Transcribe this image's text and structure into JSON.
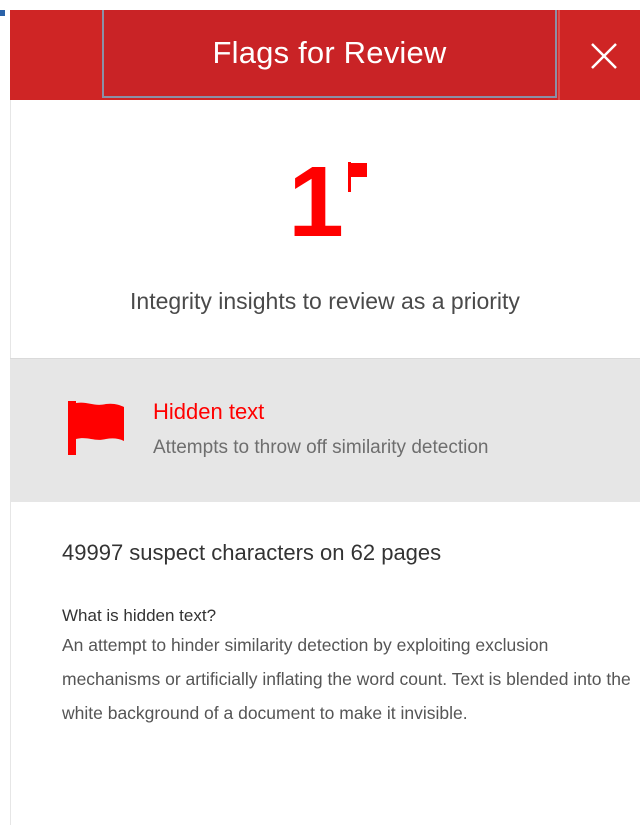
{
  "header": {
    "title": "Flags for Review",
    "close_icon": "close-icon"
  },
  "summary": {
    "count": "1",
    "text": "Integrity insights to review as a priority"
  },
  "flag_item": {
    "title": "Hidden text",
    "description": "Attempts to throw off similarity detection",
    "icon": "flag-icon"
  },
  "detail": {
    "count_text": "49997 suspect characters on 62 pages",
    "question": "What is hidden text?",
    "body": "An attempt to hinder similarity detection by exploiting exclusion mechanisms or artificially inflating the word count. Text is blended into the white background of a document to make it invisible."
  },
  "colors": {
    "header": "#cf2525",
    "accent": "#ff0000",
    "row_bg": "#e6e6e6"
  }
}
